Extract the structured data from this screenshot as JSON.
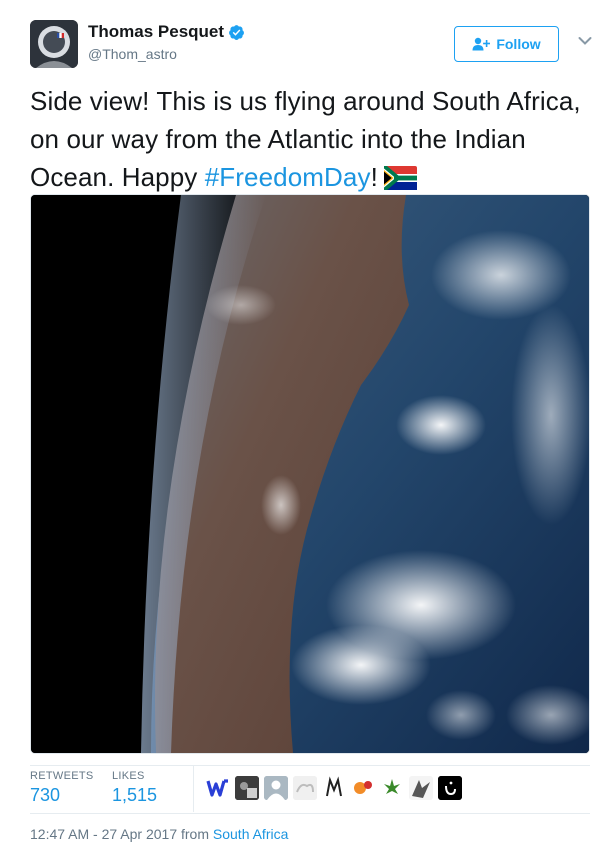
{
  "author": {
    "name": "Thomas Pesquet",
    "handle": "@Thom_astro",
    "verified_icon": "verified-badge-icon"
  },
  "actions": {
    "follow_label": "Follow",
    "more_icon": "chevron-down-icon"
  },
  "tweet": {
    "text_before": "Side view! This is us flying around South Africa, on our way from the Atlantic into the Indian Ocean. Happy ",
    "hashtag": "#FreedomDay",
    "text_after": "!",
    "emoji": "south-africa-flag-icon"
  },
  "stats": {
    "retweets_label": "RETWEETS",
    "retweets_value": "730",
    "likes_label": "LIKES",
    "likes_value": "1,515"
  },
  "meta": {
    "timestamp": "12:47 AM - 27 Apr 2017",
    "from_label": "from",
    "place": "South Africa"
  },
  "colors": {
    "accent": "#1da1f2",
    "link": "#1b95e0",
    "muted": "#657786"
  }
}
